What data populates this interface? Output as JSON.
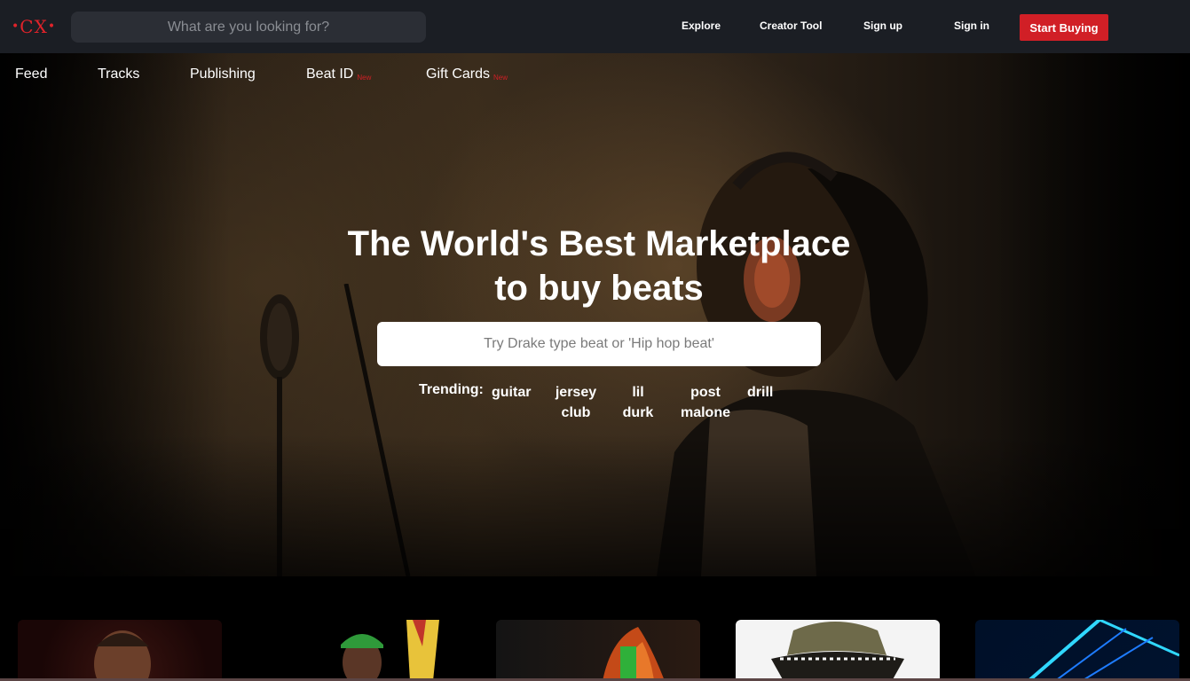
{
  "header": {
    "logo_text": "CX",
    "search_placeholder": "What are you looking for?",
    "nav": {
      "explore": "Explore",
      "creator_tool": "Creator Tool",
      "sign_up": "Sign up",
      "sign_in": "Sign in",
      "start_buying": "Start Buying"
    }
  },
  "subnav": {
    "items": [
      {
        "label": "Feed",
        "badge": ""
      },
      {
        "label": "Tracks",
        "badge": ""
      },
      {
        "label": "Publishing",
        "badge": ""
      },
      {
        "label": "Beat ID",
        "badge": "New"
      },
      {
        "label": "Gift Cards",
        "badge": "New"
      }
    ]
  },
  "hero": {
    "title_line1": "The World's Best Marketplace",
    "title_line2": "to buy beats",
    "search_placeholder": "Try Drake type beat or 'Hip hop beat'",
    "trending_label": "Trending:",
    "trending": [
      {
        "line1": "guitar",
        "line2": ""
      },
      {
        "line1": "jersey",
        "line2": "club"
      },
      {
        "line1": "lil",
        "line2": "durk"
      },
      {
        "line1": "post",
        "line2": "malone"
      },
      {
        "line1": "drill",
        "line2": ""
      }
    ]
  },
  "colors": {
    "accent": "#d11f26",
    "topbar": "#1b1e24",
    "search_bg": "#2b2e35"
  },
  "cards": [
    {
      "icon": "artist-drake-image"
    },
    {
      "icon": "artist-flag-image"
    },
    {
      "icon": "fire-bottle-image"
    },
    {
      "icon": "bucket-hat-artist-image"
    },
    {
      "icon": "neon-lights-image"
    }
  ]
}
